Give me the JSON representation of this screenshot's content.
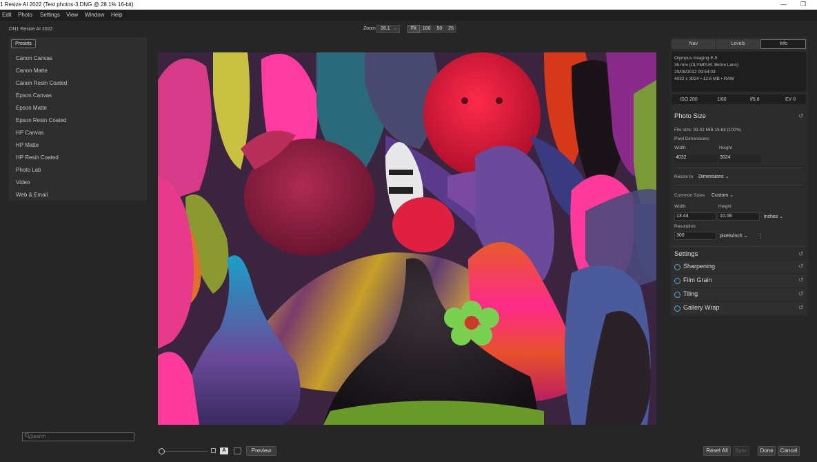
{
  "window": {
    "title": "1 Resize AI 2022 (Test photos-3.DNG @ 28.1% 16-bit)",
    "minimize_glyph": "—",
    "restore_glyph": "❐"
  },
  "menu": [
    "Edit",
    "Photo",
    "Settings",
    "View",
    "Window",
    "Help"
  ],
  "app_name": "ON1 Resize AI 2022",
  "zoom": {
    "label": "Zoom",
    "value": "28.1",
    "chevron": "⌄",
    "buttons": [
      "Fit",
      "100",
      "50",
      "25"
    ]
  },
  "left_panel": {
    "presets_button": "Presets",
    "presets": [
      "Canon Canvas",
      "Canon Matte",
      "Canon Resin Coated",
      "Epson Canvas",
      "Epson Matte",
      "Epson Resin Coated",
      "HP Canvas",
      "HP Matte",
      "HP Resin Coated",
      "Photo Lab",
      "Video",
      "Web & Email"
    ],
    "search_placeholder": "Search",
    "search_icon": "🔍︎"
  },
  "right_panel": {
    "tabs": [
      "Nav",
      "Levels",
      "Info"
    ],
    "active_tab": "Info",
    "info": {
      "camera": "Olympus Imaging E-5",
      "lens": "35 mm (OLYMPUS 35mm Lens)",
      "datetime": "20/08/2012 09:54:03",
      "dims": "4032 x 3024 • 12.6 MB • RAW"
    },
    "exif": [
      "ISO 200",
      "1/60",
      "f/5.6",
      "EV 0"
    ],
    "photo_size": {
      "title": "Photo Size",
      "file_size": "File size: 93.02 MiB 16-bit (100%)",
      "pixel_dimensions_label": "Pixel Dimensions:",
      "width_label": "Width",
      "height_label": "Height",
      "pixel_width": "4032",
      "pixel_height": "3024",
      "resize_to_label": "Resize to",
      "resize_to_value": "Dimensions",
      "common_sizes_label": "Common Sizes",
      "common_sizes_value": "Custom",
      "width": "13.44",
      "height": "10.08",
      "unit": "inches",
      "resolution_label": "Resolution",
      "resolution": "300",
      "resolution_unit": "pixels/inch",
      "more_glyph": "⋮",
      "chevron": "⌄"
    },
    "settings": {
      "title": "Settings",
      "items": [
        "Sharpening",
        "Film Grain",
        "Tiling",
        "Gallery Wrap"
      ]
    },
    "reset_glyph": "↺"
  },
  "bottom": {
    "compare_a": "A",
    "preview": "Preview",
    "reset_all": "Reset All",
    "sync": "Sync",
    "done": "Done",
    "cancel": "Cancel"
  },
  "colors": {
    "background": "#262626",
    "panel": "#2e2e2e",
    "accent_circle": "#5aa7d6"
  }
}
